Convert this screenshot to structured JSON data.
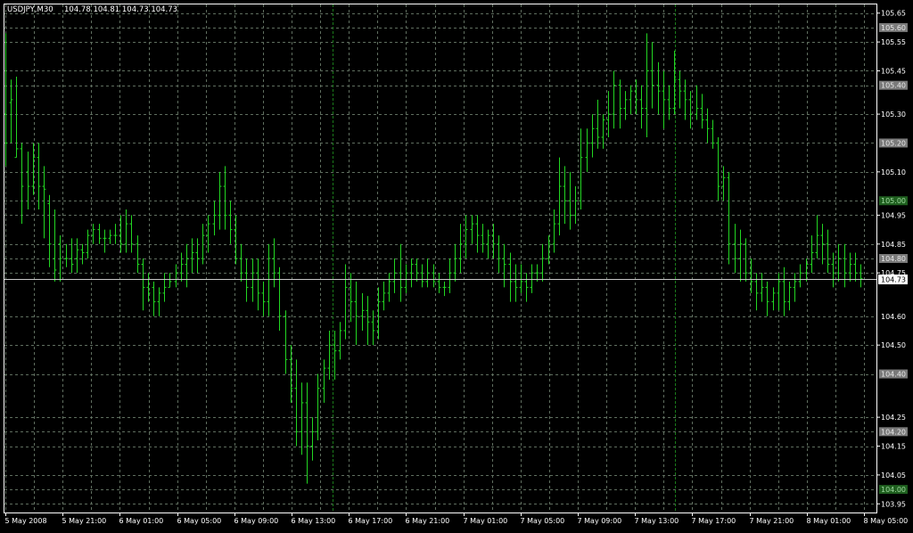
{
  "header": {
    "symbol": "USDJPY,M30",
    "ohlc": "104.78 104.81 104.73 104.73"
  },
  "colors": {
    "background": "#000000",
    "grid": "#5f6e5f",
    "bars": "#22d622",
    "axis": "#ffffff",
    "current_price_line": "#c8c8c8",
    "level_box_gray": "#7a7a7a",
    "level_box_green": "#1f5f1f",
    "separator": "#1a7a1a"
  },
  "chart_data": {
    "type": "ohlc",
    "timeframe": "M30",
    "ylim": [
      103.92,
      105.68
    ],
    "y_ticks": [
      "105.65",
      "105.55",
      "105.45",
      "105.30",
      "105.10",
      "104.95",
      "104.85",
      "104.75",
      "104.50",
      "104.25",
      "104.15",
      "104.05",
      "103.95"
    ],
    "level_boxes": [
      {
        "label": "105.60",
        "value": 105.6,
        "style": "gray"
      },
      {
        "label": "105.40",
        "value": 105.4,
        "style": "gray"
      },
      {
        "label": "105.20",
        "value": 105.2,
        "style": "gray"
      },
      {
        "label": "105.00",
        "value": 105.0,
        "style": "green"
      },
      {
        "label": "104.80",
        "value": 104.8,
        "style": "gray"
      },
      {
        "label": "104.60",
        "value": 104.6,
        "style": "plain"
      },
      {
        "label": "104.40",
        "value": 104.4,
        "style": "gray"
      },
      {
        "label": "104.20",
        "value": 104.2,
        "style": "gray"
      },
      {
        "label": "104.00",
        "value": 104.0,
        "style": "green"
      }
    ],
    "current_price": {
      "label": "104.73",
      "value": 104.73
    },
    "x_labels": [
      "5 May 2008",
      "5 May 21:00",
      "6 May 01:00",
      "6 May 05:00",
      "6 May 09:00",
      "6 May 13:00",
      "6 May 17:00",
      "6 May 21:00",
      "7 May 01:00",
      "7 May 05:00",
      "7 May 09:00",
      "7 May 13:00",
      "7 May 17:00",
      "7 May 21:00",
      "8 May 01:00",
      "8 May 05:00"
    ],
    "bars": [
      [
        105.3,
        105.58,
        105.12,
        105.2
      ],
      [
        105.34,
        105.42,
        105.2,
        105.35
      ],
      [
        105.15,
        105.43,
        105.15,
        105.18
      ],
      [
        105.18,
        105.2,
        104.92,
        105.05
      ],
      [
        105.1,
        105.17,
        104.97,
        105.05
      ],
      [
        105.05,
        105.2,
        105.02,
        105.15
      ],
      [
        105.15,
        105.2,
        104.97,
        105.05
      ],
      [
        105.05,
        105.12,
        104.87,
        105.04
      ],
      [
        104.99,
        105.02,
        104.77,
        104.85
      ],
      [
        104.8,
        104.97,
        104.72,
        104.76
      ],
      [
        104.85,
        104.88,
        104.72,
        104.8
      ],
      [
        104.8,
        104.85,
        104.77,
        104.8
      ],
      [
        104.8,
        104.87,
        104.75,
        104.78
      ],
      [
        104.8,
        104.87,
        104.75,
        104.83
      ],
      [
        104.83,
        104.85,
        104.78,
        104.82
      ],
      [
        104.82,
        104.9,
        104.8,
        104.88
      ],
      [
        104.88,
        104.92,
        104.85,
        104.9
      ],
      [
        104.9,
        104.92,
        104.85,
        104.87
      ],
      [
        104.87,
        104.9,
        104.82,
        104.87
      ],
      [
        104.87,
        104.9,
        104.85,
        104.88
      ],
      [
        104.88,
        104.92,
        104.85,
        104.88
      ],
      [
        104.88,
        104.95,
        104.82,
        104.85
      ],
      [
        104.85,
        104.97,
        104.82,
        104.92
      ],
      [
        104.92,
        104.95,
        104.82,
        104.85
      ],
      [
        104.85,
        104.88,
        104.75,
        104.78
      ],
      [
        104.78,
        104.8,
        104.62,
        104.7
      ],
      [
        104.7,
        104.75,
        104.65,
        104.68
      ],
      [
        104.7,
        104.72,
        104.6,
        104.65
      ],
      [
        104.65,
        104.7,
        104.6,
        104.68
      ],
      [
        104.68,
        104.75,
        104.65,
        104.7
      ],
      [
        104.7,
        104.75,
        104.7,
        104.72
      ],
      [
        104.72,
        104.78,
        104.7,
        104.75
      ],
      [
        104.75,
        104.82,
        104.72,
        104.78
      ],
      [
        104.78,
        104.85,
        104.7,
        104.8
      ],
      [
        104.8,
        104.87,
        104.75,
        104.82
      ],
      [
        104.82,
        104.87,
        104.75,
        104.8
      ],
      [
        104.8,
        104.92,
        104.78,
        104.88
      ],
      [
        104.88,
        104.95,
        104.82,
        104.92
      ],
      [
        104.92,
        105.0,
        104.88,
        104.95
      ],
      [
        104.95,
        105.1,
        104.9,
        105.05
      ],
      [
        105.05,
        105.12,
        104.9,
        104.95
      ],
      [
        104.95,
        105.0,
        104.85,
        104.9
      ],
      [
        104.9,
        104.95,
        104.78,
        104.8
      ],
      [
        104.8,
        104.85,
        104.72,
        104.75
      ],
      [
        104.75,
        104.8,
        104.65,
        104.7
      ],
      [
        104.7,
        104.8,
        104.65,
        104.75
      ],
      [
        104.75,
        104.8,
        104.62,
        104.68
      ],
      [
        104.68,
        104.72,
        104.6,
        104.65
      ],
      [
        104.65,
        104.85,
        104.6,
        104.8
      ],
      [
        104.8,
        104.87,
        104.7,
        104.75
      ],
      [
        104.75,
        104.77,
        104.55,
        104.6
      ],
      [
        104.6,
        104.62,
        104.4,
        104.45
      ],
      [
        104.45,
        104.5,
        104.3,
        104.35
      ],
      [
        104.35,
        104.45,
        104.15,
        104.2
      ],
      [
        104.2,
        104.37,
        104.12,
        104.3
      ],
      [
        104.3,
        104.37,
        104.02,
        104.15
      ],
      [
        104.15,
        104.25,
        104.1,
        104.2
      ],
      [
        104.2,
        104.4,
        104.17,
        104.35
      ],
      [
        104.35,
        104.45,
        104.3,
        104.42
      ],
      [
        104.42,
        104.55,
        104.38,
        104.5
      ],
      [
        104.5,
        104.55,
        104.38,
        104.48
      ],
      [
        104.48,
        104.58,
        104.45,
        104.55
      ],
      [
        104.55,
        104.78,
        104.52,
        104.7
      ],
      [
        104.7,
        104.75,
        104.58,
        104.65
      ],
      [
        104.65,
        104.72,
        104.5,
        104.6
      ],
      [
        104.6,
        104.68,
        104.55,
        104.62
      ],
      [
        104.62,
        104.67,
        104.5,
        104.58
      ],
      [
        104.58,
        104.62,
        104.5,
        104.55
      ],
      [
        104.55,
        104.7,
        104.52,
        104.65
      ],
      [
        104.65,
        104.72,
        104.62,
        104.68
      ],
      [
        104.68,
        104.75,
        104.65,
        104.72
      ],
      [
        104.72,
        104.8,
        104.68,
        104.75
      ],
      [
        104.75,
        104.85,
        104.65,
        104.7
      ],
      [
        104.7,
        104.78,
        104.68,
        104.75
      ],
      [
        104.75,
        104.8,
        104.7,
        104.78
      ],
      [
        104.78,
        104.8,
        104.72,
        104.75
      ],
      [
        104.75,
        104.78,
        104.7,
        104.72
      ],
      [
        104.72,
        104.8,
        104.7,
        104.75
      ],
      [
        104.75,
        104.78,
        104.7,
        104.72
      ],
      [
        104.72,
        104.75,
        104.68,
        104.7
      ],
      [
        104.7,
        104.72,
        104.67,
        104.7
      ],
      [
        104.7,
        104.8,
        104.68,
        104.75
      ],
      [
        104.75,
        104.85,
        104.72,
        104.8
      ],
      [
        104.8,
        104.92,
        104.75,
        104.85
      ],
      [
        104.85,
        104.95,
        104.8,
        104.9
      ],
      [
        104.9,
        104.95,
        104.85,
        104.92
      ],
      [
        104.92,
        104.95,
        104.82,
        104.88
      ],
      [
        104.88,
        104.92,
        104.82,
        104.85
      ],
      [
        104.85,
        104.9,
        104.8,
        104.88
      ],
      [
        104.88,
        104.92,
        104.8,
        104.85
      ],
      [
        104.85,
        104.88,
        104.75,
        104.8
      ],
      [
        104.8,
        104.85,
        104.7,
        104.78
      ],
      [
        104.78,
        104.82,
        104.65,
        104.72
      ],
      [
        104.72,
        104.78,
        104.65,
        104.7
      ],
      [
        104.7,
        104.78,
        104.68,
        104.72
      ],
      [
        104.72,
        104.75,
        104.65,
        104.7
      ],
      [
        104.7,
        104.78,
        104.68,
        104.75
      ],
      [
        104.75,
        104.78,
        104.72,
        104.75
      ],
      [
        104.75,
        104.85,
        104.72,
        104.8
      ],
      [
        104.8,
        104.88,
        104.78,
        104.85
      ],
      [
        104.85,
        104.97,
        104.82,
        104.92
      ],
      [
        104.92,
        105.15,
        104.88,
        105.05
      ],
      [
        105.05,
        105.12,
        104.92,
        105.0
      ],
      [
        105.0,
        105.1,
        104.9,
        104.95
      ],
      [
        104.95,
        105.05,
        104.92,
        105.0
      ],
      [
        105.0,
        105.25,
        104.97,
        105.15
      ],
      [
        105.15,
        105.25,
        105.1,
        105.2
      ],
      [
        105.2,
        105.3,
        105.15,
        105.25
      ],
      [
        105.25,
        105.35,
        105.18,
        105.22
      ],
      [
        105.22,
        105.3,
        105.18,
        105.28
      ],
      [
        105.28,
        105.38,
        105.22,
        105.3
      ],
      [
        105.3,
        105.45,
        105.25,
        105.4
      ],
      [
        105.4,
        105.42,
        105.25,
        105.32
      ],
      [
        105.32,
        105.38,
        105.28,
        105.35
      ],
      [
        105.35,
        105.4,
        105.3,
        105.38
      ],
      [
        105.38,
        105.42,
        105.3,
        105.35
      ],
      [
        105.35,
        105.4,
        105.25,
        105.32
      ],
      [
        105.32,
        105.58,
        105.22,
        105.45
      ],
      [
        105.45,
        105.55,
        105.32,
        105.4
      ],
      [
        105.4,
        105.48,
        105.3,
        105.38
      ],
      [
        105.38,
        105.45,
        105.25,
        105.35
      ],
      [
        105.35,
        105.4,
        105.28,
        105.32
      ],
      [
        105.32,
        105.52,
        105.3,
        105.42
      ],
      [
        105.42,
        105.45,
        105.32,
        105.38
      ],
      [
        105.38,
        105.42,
        105.28,
        105.35
      ],
      [
        105.35,
        105.38,
        105.25,
        105.3
      ],
      [
        105.3,
        105.4,
        105.28,
        105.32
      ],
      [
        105.32,
        105.37,
        105.25,
        105.28
      ],
      [
        105.28,
        105.32,
        105.2,
        105.25
      ],
      [
        105.25,
        105.28,
        105.18,
        105.2
      ],
      [
        105.2,
        105.22,
        105.0,
        105.05
      ],
      [
        105.05,
        105.12,
        105.0,
        105.08
      ],
      [
        105.08,
        105.1,
        104.78,
        104.85
      ],
      [
        104.85,
        104.92,
        104.75,
        104.8
      ],
      [
        104.8,
        104.9,
        104.72,
        104.85
      ],
      [
        104.85,
        104.87,
        104.72,
        104.75
      ],
      [
        104.75,
        104.8,
        104.68,
        104.72
      ],
      [
        104.72,
        104.75,
        104.62,
        104.68
      ],
      [
        104.68,
        104.75,
        104.65,
        104.7
      ],
      [
        104.7,
        104.72,
        104.6,
        104.65
      ],
      [
        104.65,
        104.7,
        104.62,
        104.68
      ],
      [
        104.68,
        104.75,
        104.62,
        104.72
      ],
      [
        104.72,
        104.77,
        104.6,
        104.65
      ],
      [
        104.65,
        104.72,
        104.62,
        104.7
      ],
      [
        104.7,
        104.75,
        104.65,
        104.72
      ],
      [
        104.72,
        104.78,
        104.7,
        104.75
      ],
      [
        104.75,
        104.8,
        104.72,
        104.78
      ],
      [
        104.78,
        104.88,
        104.75,
        104.82
      ],
      [
        104.82,
        104.95,
        104.8,
        104.88
      ],
      [
        104.88,
        104.92,
        104.78,
        104.85
      ],
      [
        104.85,
        104.9,
        104.75,
        104.78
      ],
      [
        104.78,
        104.82,
        104.7,
        104.75
      ],
      [
        104.75,
        104.85,
        104.72,
        104.8
      ],
      [
        104.8,
        104.85,
        104.7,
        104.75
      ],
      [
        104.75,
        104.82,
        104.72,
        104.78
      ],
      [
        104.78,
        104.82,
        104.72,
        104.75
      ],
      [
        104.75,
        104.78,
        104.7,
        104.73
      ]
    ]
  }
}
